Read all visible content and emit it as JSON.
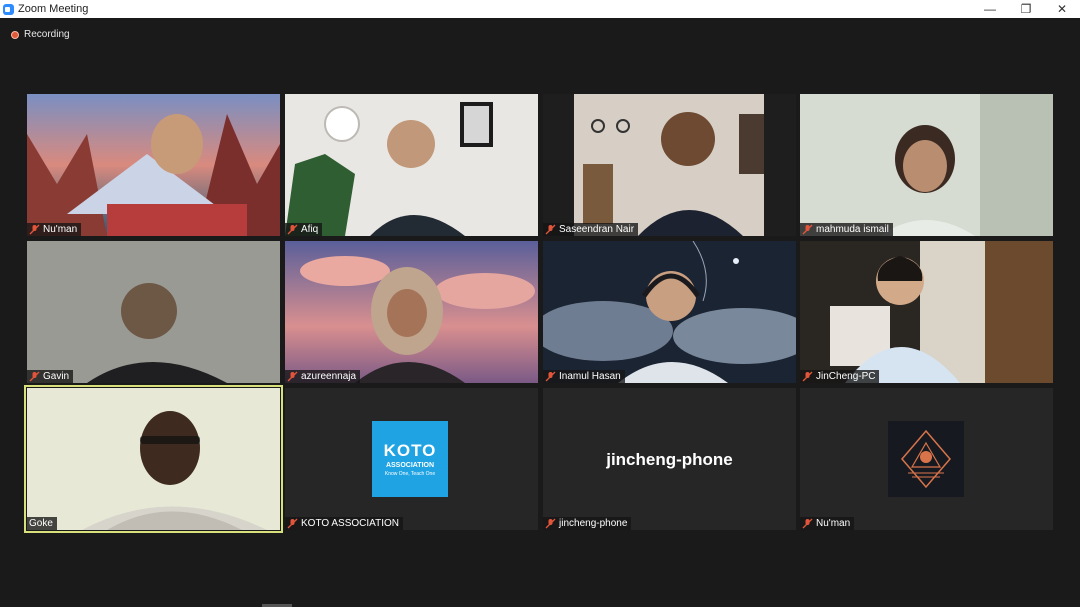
{
  "window": {
    "title": "Zoom Meeting",
    "controls": {
      "minimize": "—",
      "restore": "❐",
      "close": "✕"
    }
  },
  "recording": {
    "label": "Recording"
  },
  "participants": [
    {
      "name": "Nu'man"
    },
    {
      "name": "Afiq"
    },
    {
      "name": "Saseendran Nair"
    },
    {
      "name": "mahmuda ismail"
    },
    {
      "name": "Gavin"
    },
    {
      "name": "azureennaja"
    },
    {
      "name": "Inamul Hasan"
    },
    {
      "name": "JinCheng-PC"
    },
    {
      "name": "Goke",
      "active_speaker": true
    },
    {
      "name": "KOTO ASSOCIATION",
      "logo_text": "KOTO",
      "logo_sub": "ASSOCIATION",
      "logo_tagline": "Know One, Teach One"
    },
    {
      "name": "jincheng-phone",
      "display_text": "jincheng-phone"
    },
    {
      "name": "Nu'man"
    }
  ],
  "colors": {
    "accent_active_speaker": "#d7e07a",
    "muted_mic": "#e2553a",
    "koto_blue": "#1fa3e3",
    "recording_dot": "#e05a3a"
  }
}
